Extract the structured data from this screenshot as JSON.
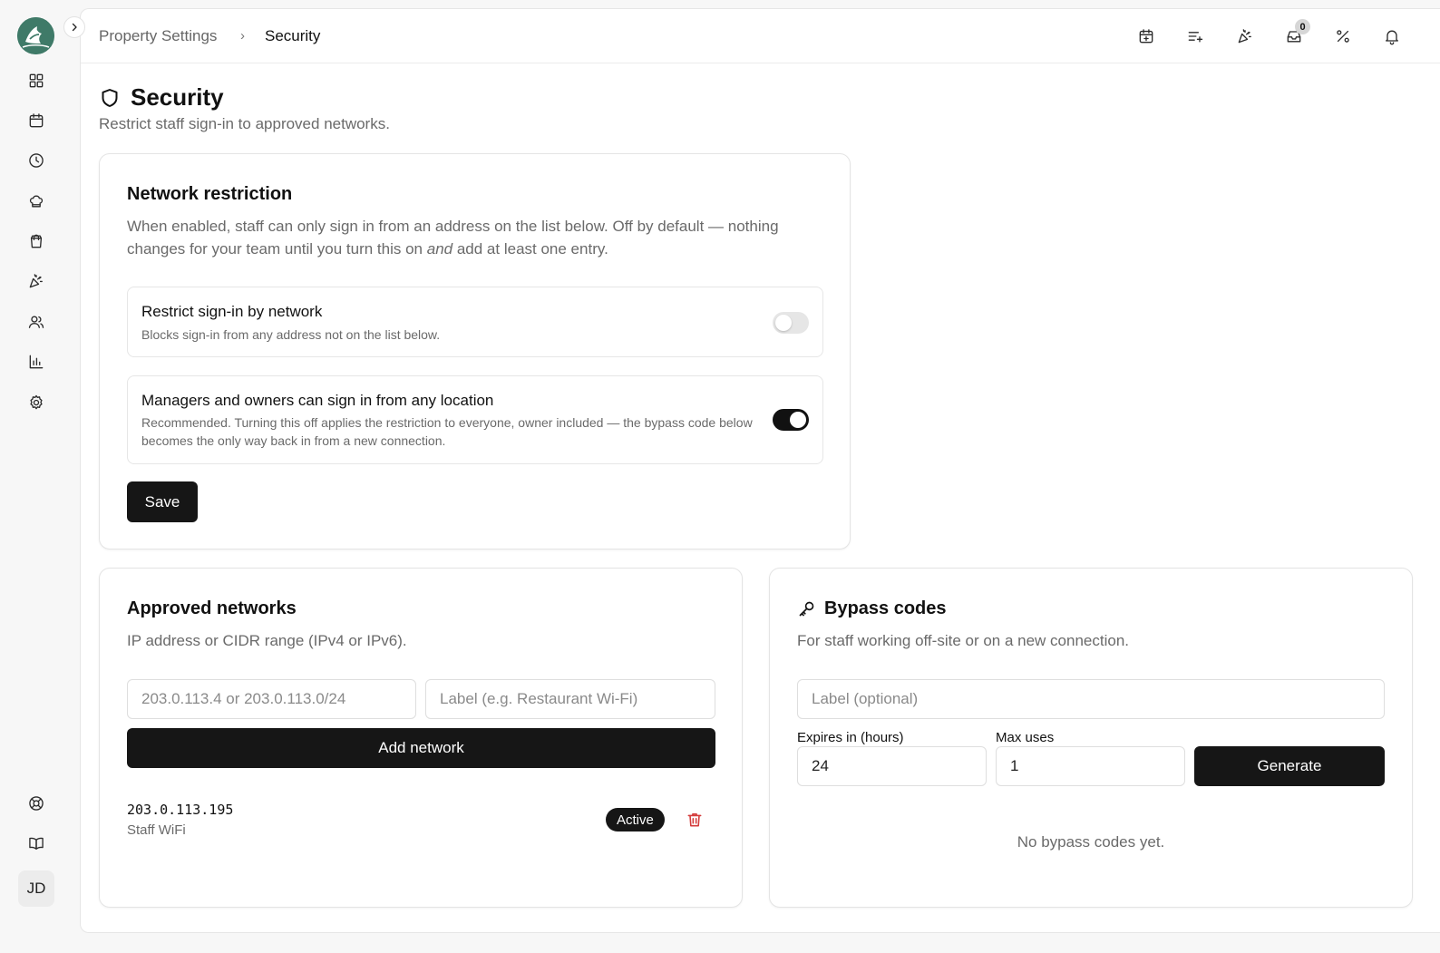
{
  "app": {
    "user_initials": "JD"
  },
  "breadcrumb": {
    "parent": "Property Settings",
    "separator": "›",
    "current": "Security"
  },
  "topbar": {
    "inbox_count": "0"
  },
  "page": {
    "title": "Security",
    "subtitle": "Restrict staff sign-in to approved networks."
  },
  "network_restriction": {
    "title": "Network restriction",
    "desc_before": "When enabled, staff can only sign in from an address on the list below. Off by default — nothing changes for your team until you turn this on ",
    "desc_emph": "and",
    "desc_after": " add at least one entry.",
    "restrict": {
      "title": "Restrict sign-in by network",
      "desc": "Blocks sign-in from any address not on the list below.",
      "enabled": false
    },
    "managers": {
      "title": "Managers and owners can sign in from any location",
      "desc": "Recommended. Turning this off applies the restriction to everyone, owner included — the bypass code below becomes the only way back in from a new connection.",
      "enabled": true
    },
    "save_label": "Save"
  },
  "approved_networks": {
    "title": "Approved networks",
    "desc": "IP address or CIDR range (IPv4 or IPv6).",
    "address_placeholder": "203.0.113.4 or 203.0.113.0/24",
    "label_placeholder": "Label (e.g. Restaurant Wi-Fi)",
    "add_label": "Add network",
    "entries": [
      {
        "ip": "203.0.113.195",
        "label": "Staff WiFi",
        "status": "Active"
      }
    ]
  },
  "bypass_codes": {
    "title": "Bypass codes",
    "desc": "For staff working off-site or on a new connection.",
    "label_placeholder": "Label (optional)",
    "expires_label": "Expires in (hours)",
    "expires_value": "24",
    "max_uses_label": "Max uses",
    "max_uses_value": "1",
    "generate_label": "Generate",
    "empty_message": "No bypass codes yet."
  },
  "colors": {
    "accent": "#3f7a68",
    "dark": "#161616",
    "danger": "#d43c3c"
  }
}
